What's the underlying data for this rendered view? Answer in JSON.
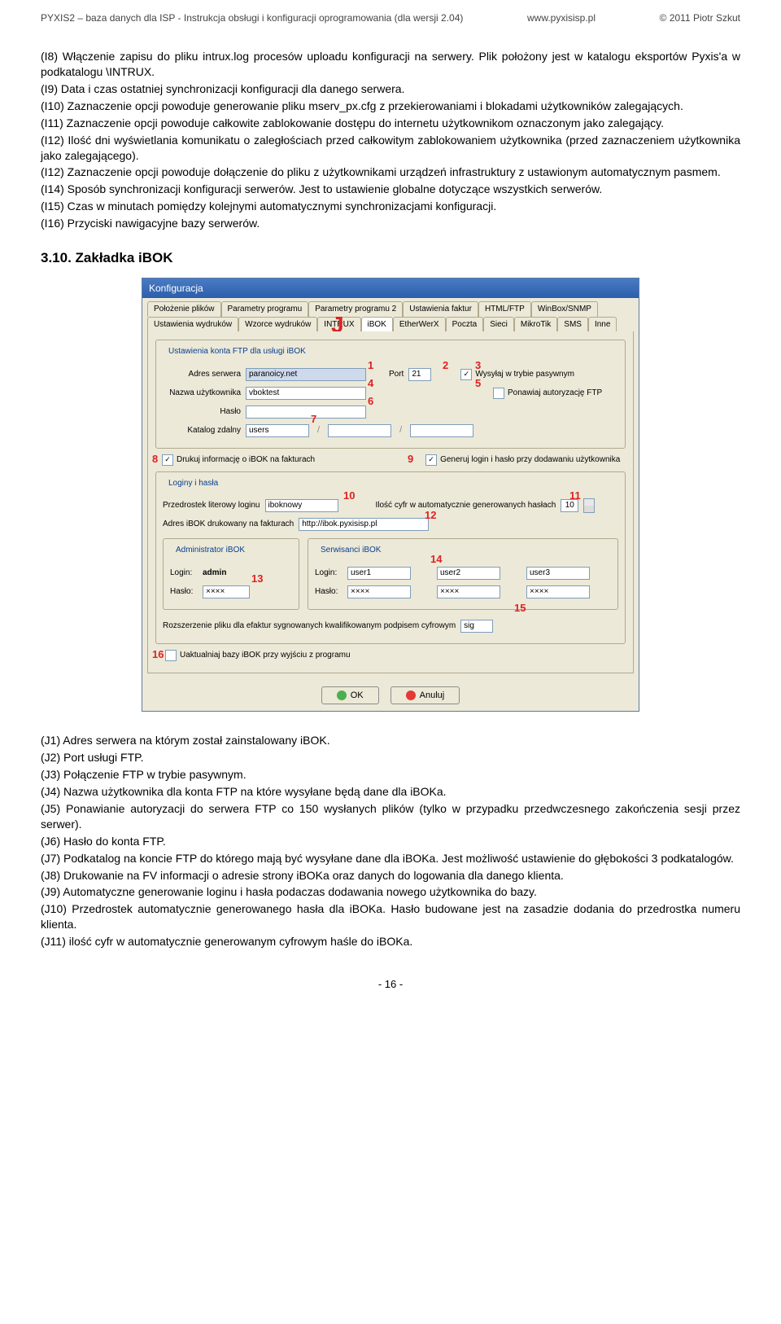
{
  "header": {
    "left": "PYXIS2 – baza danych dla ISP - Instrukcja obsługi i konfiguracji oprogramowania (dla wersji 2.04)",
    "center": "www.pyxisisp.pl",
    "right": "© 2011 Piotr Szkut"
  },
  "topText": [
    "(I8) Włączenie zapisu do pliku intrux.log procesów uploadu konfiguracji na serwery. Plik położony jest w katalogu eksportów Pyxis'a w podkatalogu \\INTRUX.",
    "(I9) Data i czas ostatniej synchronizacji konfiguracji dla danego serwera.",
    "(I10) Zaznaczenie opcji powoduje generowanie pliku mserv_px.cfg z przekierowaniami i blokadami użytkowników zalegających.",
    "(I11) Zaznaczenie opcji powoduje całkowite zablokowanie dostępu do internetu użytkownikom oznaczonym jako zalegający.",
    "(I12) Ilość dni wyświetlania komunikatu o zaległościach przed całkowitym zablokowaniem użytkownika (przed zaznaczeniem użytkownika jako zalegającego).",
    "(I12) Zaznaczenie opcji powoduje dołączenie do pliku z użytkownikami urządzeń infrastruktury z ustawionym automatycznym pasmem.",
    "(I14) Sposób synchronizacji konfiguracji serwerów. Jest to ustawienie globalne dotyczące wszystkich serwerów.",
    "(I15) Czas w minutach pomiędzy kolejnymi automatycznymi synchronizacjami konfiguracji.",
    "(I16) Przyciski nawigacyjne bazy serwerów."
  ],
  "sectionTitle": "3.10.  Zakładka iBOK",
  "dlg": {
    "title": "Konfiguracja",
    "tabsRow1": [
      "Położenie plików",
      "Parametry programu",
      "Parametry programu 2",
      "Ustawienia faktur",
      "HTML/FTP",
      "WinBox/SNMP"
    ],
    "tabsRow2": [
      "Ustawienia wydruków",
      "Wzorce wydruków",
      "INTRUX",
      "iBOK",
      "EtherWerX",
      "Poczta",
      "Sieci",
      "MikroTik",
      "SMS",
      "Inne"
    ],
    "selectedTab": "iBOK",
    "marker": "J",
    "grp_ftp": "Ustawienia konta FTP dla usługi iBOK",
    "lbl_server": "Adres serwera",
    "val_server": "paranoicy.net",
    "lbl_port": "Port",
    "val_port": "21",
    "chk_passive": "Wysyłaj w trybie pasywnym",
    "lbl_user": "Nazwa użytkownika",
    "val_user": "vboktest",
    "chk_reauth": "Ponawiaj autoryzację FTP",
    "lbl_pass": "Hasło",
    "lbl_remote": "Katalog zdalny",
    "val_remote": "users",
    "chk_printFV": "Drukuj informację o iBOK na fakturach",
    "chk_genLogin": "Generuj login i hasło przy dodawaniu użytkownika",
    "grp_login": "Loginy i hasła",
    "lbl_prefix": "Przedrostek literowy loginu",
    "val_prefix": "iboknowy",
    "lbl_digits": "Ilość cyfr w automatycznie generowanych hasłach",
    "val_digits": "10",
    "lbl_url": "Adres iBOK drukowany na fakturach",
    "val_url": "http://ibok.pyxisisp.pl",
    "grp_admin": "Administrator iBOK",
    "grp_serv": "Serwisanci iBOK",
    "lbl_login": "Login:",
    "val_admin": "admin",
    "val_u1": "user1",
    "val_u2": "user2",
    "val_u3": "user3",
    "lbl_hpass": "Hasło:",
    "mask": "××××",
    "lbl_ext": "Rozszerzenie pliku dla efaktur sygnowanych kwalifikowanym podpisem cyfrowym",
    "val_ext": "sig",
    "chk_update": "Uaktualniaj bazy iBOK przy wyjściu z programu",
    "btn_ok": "OK",
    "btn_cancel": "Anuluj",
    "n": {
      "1": "1",
      "2": "2",
      "3": "3",
      "4": "4",
      "5": "5",
      "6": "6",
      "7": "7",
      "8": "8",
      "9": "9",
      "10": "10",
      "11": "11",
      "12": "12",
      "13": "13",
      "14": "14",
      "15": "15",
      "16": "16"
    }
  },
  "bottomText": [
    "(J1) Adres serwera na którym został zainstalowany iBOK.",
    "(J2) Port usługi FTP.",
    "(J3) Połączenie FTP w trybie pasywnym.",
    "(J4) Nazwa użytkownika dla konta FTP na które wysyłane będą dane dla iBOKa.",
    "(J5) Ponawianie autoryzacji do serwera FTP co 150 wysłanych plików (tylko w przypadku przedwczesnego zakończenia sesji przez serwer).",
    "(J6) Hasło do konta FTP.",
    "(J7) Podkatalog na koncie FTP do którego mają być wysyłane dane dla iBOKa. Jest możliwość ustawienie do głębokości 3 podkatalogów.",
    "(J8) Drukowanie na FV informacji o adresie strony iBOKa oraz danych do logowania dla danego klienta.",
    "(J9) Automatyczne generowanie loginu i hasła podaczas dodawania nowego użytkownika do bazy.",
    "(J10) Przedrostek automatycznie generowanego hasła dla iBOKa. Hasło budowane jest na zasadzie dodania do przedrostka numeru klienta.",
    "(J11) ilość cyfr w automatycznie generowanym cyfrowym haśle do iBOKa."
  ],
  "pageNum": "- 16 -"
}
